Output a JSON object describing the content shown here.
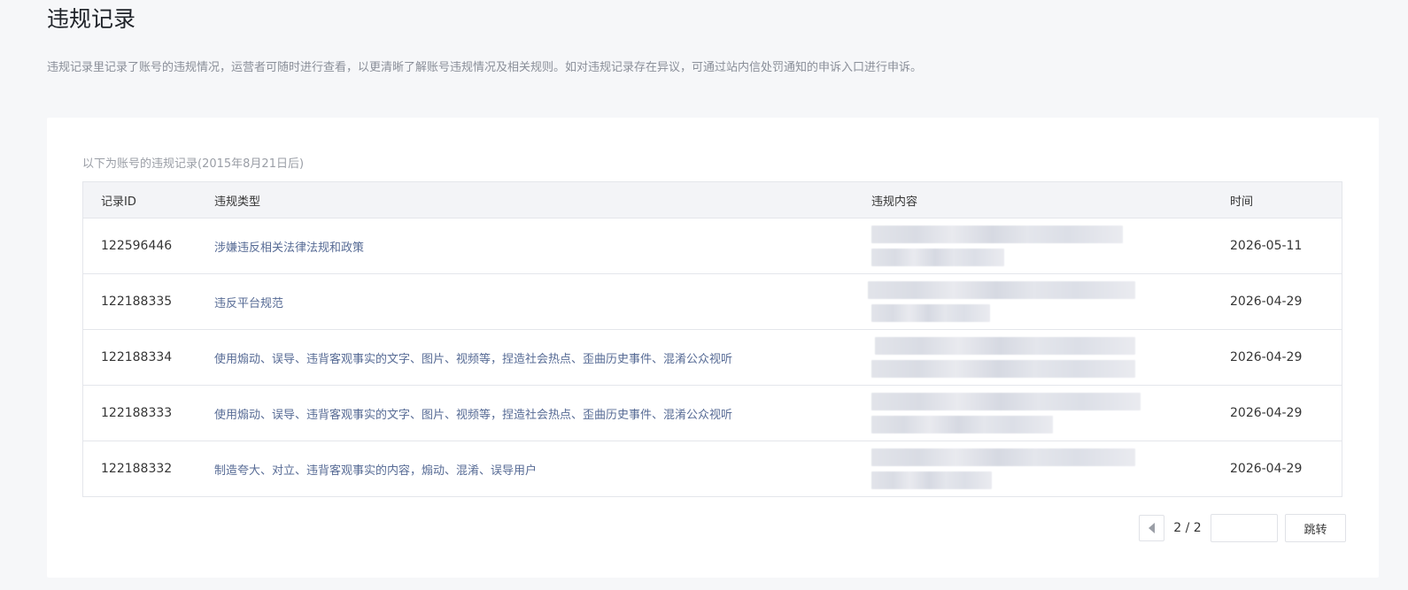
{
  "page": {
    "title": "违规记录",
    "description": "违规记录里记录了账号的违规情况，运营者可随时进行查看，以更清晰了解账号违规情况及相关规则。如对违规记录存在异议，可通过站内信处罚通知的申诉入口进行申诉。"
  },
  "records": {
    "caption": "以下为账号的违规记录(2015年8月21日后)",
    "columns": {
      "id": "记录ID",
      "type": "违规类型",
      "content": "违规内容",
      "time": "时间"
    },
    "rows": [
      {
        "id": "122596446",
        "type": "涉嫌违反相关法律法规和政策",
        "time": "2026-05-11"
      },
      {
        "id": "122188335",
        "type": "违反平台规范",
        "time": "2026-04-29"
      },
      {
        "id": "122188334",
        "type": "使用煽动、误导、违背客观事实的文字、图片、视频等，捏造社会热点、歪曲历史事件、混淆公众视听",
        "time": "2026-04-29"
      },
      {
        "id": "122188333",
        "type": "使用煽动、误导、违背客观事实的文字、图片、视频等，捏造社会热点、歪曲历史事件、混淆公众视听",
        "time": "2026-04-29"
      },
      {
        "id": "122188332",
        "type": "制造夸大、对立、违背客观事实的内容，煽动、混淆、误导用户",
        "time": "2026-04-29"
      }
    ]
  },
  "pagination": {
    "page_indicator": "2 / 2",
    "jump_input_value": "",
    "jump_button": "跳转"
  }
}
